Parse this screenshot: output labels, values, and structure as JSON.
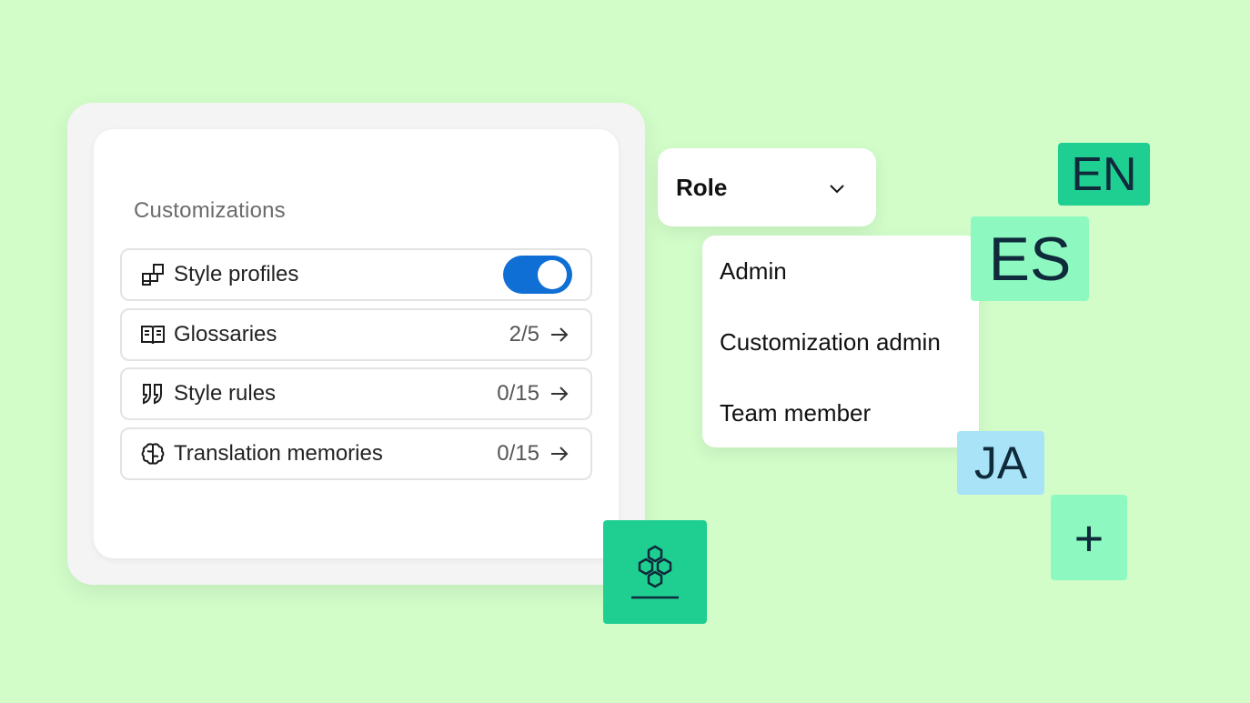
{
  "panel": {
    "title": "Customizations",
    "items": [
      {
        "label": "Style profiles",
        "icon": "style-profiles-icon",
        "toggle_on": true
      },
      {
        "label": "Glossaries",
        "icon": "book-icon",
        "count": "2/5"
      },
      {
        "label": "Style rules",
        "icon": "quote-icon",
        "count": "0/15"
      },
      {
        "label": "Translation memories",
        "icon": "brain-icon",
        "count": "0/15"
      }
    ]
  },
  "role": {
    "label": "Role",
    "options": [
      "Admin",
      "Customization admin",
      "Team member"
    ]
  },
  "languages": [
    "EN",
    "ES",
    "JA"
  ],
  "plus_symbol": "+",
  "colors": {
    "background": "#d2fdc9",
    "toggle": "#0f6fd4",
    "tile_green": "#1fcf92",
    "tile_mint": "#8df9c0",
    "tile_blue": "#a8e3f7"
  }
}
